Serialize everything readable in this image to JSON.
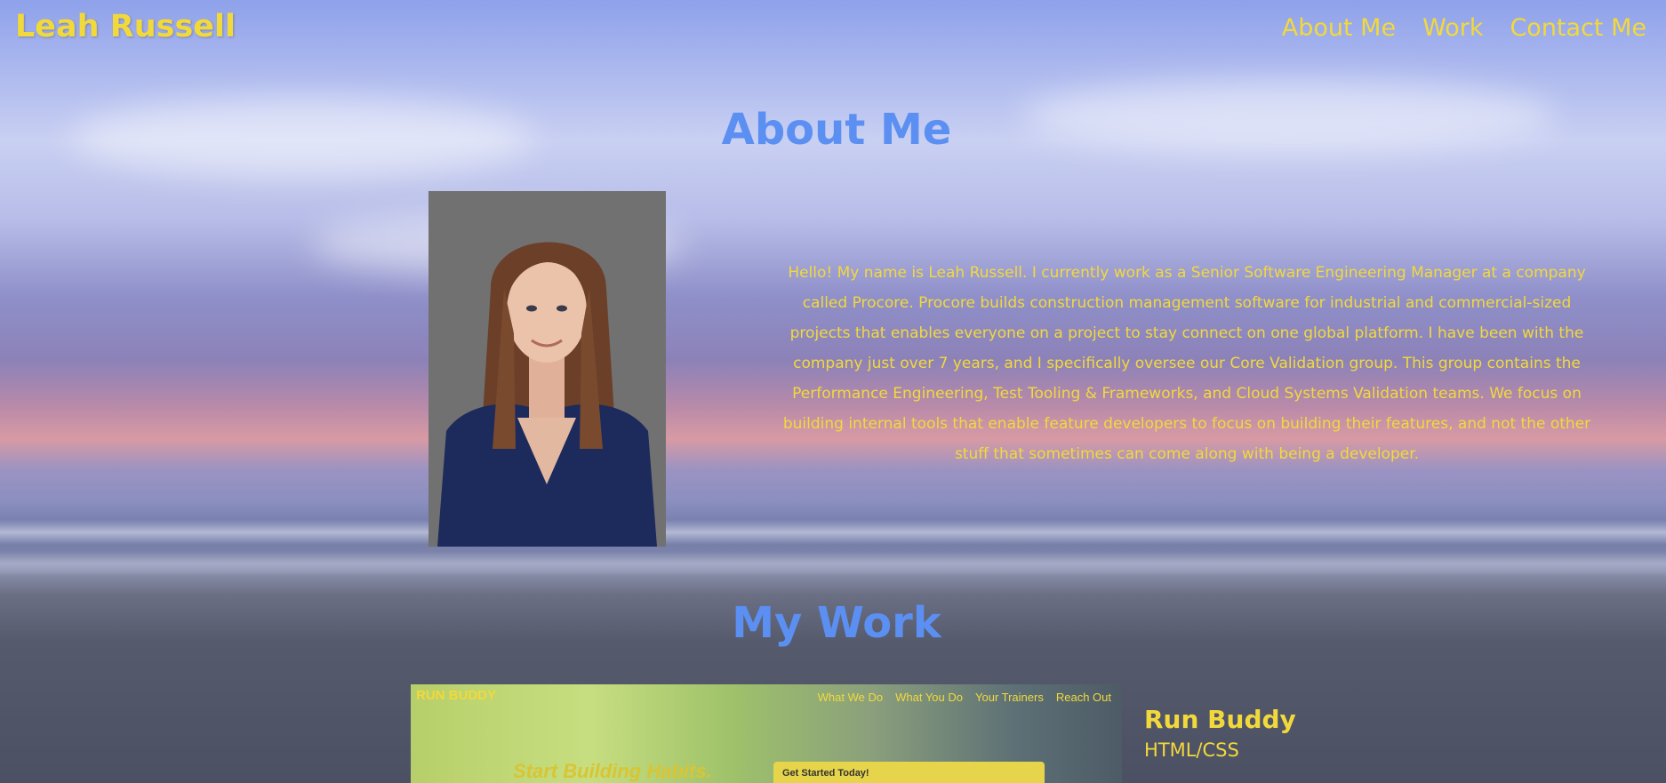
{
  "header": {
    "brand": "Leah Russell",
    "nav": [
      "About Me",
      "Work",
      "Contact Me"
    ]
  },
  "about": {
    "title": "About Me",
    "bio": "Hello! My name is Leah Russell. I currently work as a Senior Software Engineering Manager at a company called Procore. Procore builds construction management software for industrial and commercial-sized projects that enables everyone on a project to stay connect on one global platform. I have been with the company just over 7 years, and I specifically oversee our Core Validation group. This group contains the Performance Engineering, Test Tooling & Frameworks, and Cloud Systems Validation teams. We focus on building internal tools that enable feature developers to focus on building their features, and not the other stuff that sometimes can come along with being a developer."
  },
  "work": {
    "title": "My Work",
    "projects": [
      {
        "name": "Run Buddy",
        "tech": "HTML/CSS",
        "thumb": {
          "brand": "RUN BUDDY",
          "nav": [
            "What We Do",
            "What You Do",
            "Your Trainers",
            "Reach Out"
          ],
          "headline": "Start Building Habits.",
          "cta": "Get Started Today!"
        }
      }
    ]
  },
  "colors": {
    "accent_yellow": "#f2d93b",
    "heading_blue": "#5b8ff2"
  }
}
